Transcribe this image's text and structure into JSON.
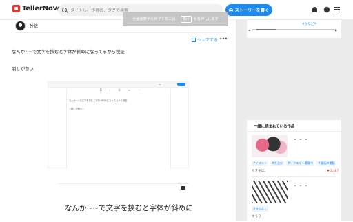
{
  "header": {
    "logo_text": "TellerNovel",
    "search_placeholder": "タイトル、作者名、タグで検索",
    "cta_label": "ストーリーを書く"
  },
  "overlay": {
    "text_before": "全画面表示を終了するには、",
    "key": "Esc",
    "text_after": "を長押しします"
  },
  "story": {
    "author": "怜依",
    "share_label": "シェアする",
    "paragraph1": "なんか~~で文字を挟むと字体が斜めになってるから検証",
    "paragraph2": "崩しが尊い"
  },
  "embed1": {
    "toolbar": "B I U ≡ ⋯",
    "line1": "なんか~~で文字を挟むと字体が斜めになってるから検証",
    "line2": "~崩しが尊い~"
  },
  "embed2": {
    "text": "なんか~~で文字を挟むと字体が斜めに"
  },
  "sidebar": {
    "top_tag": "#かなどや",
    "section_title": "一緒に読まれている作品",
    "items": [
      {
        "dots": "・・・",
        "tags": [
          "#イラスト",
          "#たなか",
          "#リクエスト募集中",
          "#漫画の書籍"
        ],
        "meta": "やきそば。",
        "likes": "♥ 2,487"
      },
      {
        "dots": "・・・",
        "tags": [
          "#ラグなし"
        ],
        "meta": "ゆうり"
      }
    ]
  }
}
